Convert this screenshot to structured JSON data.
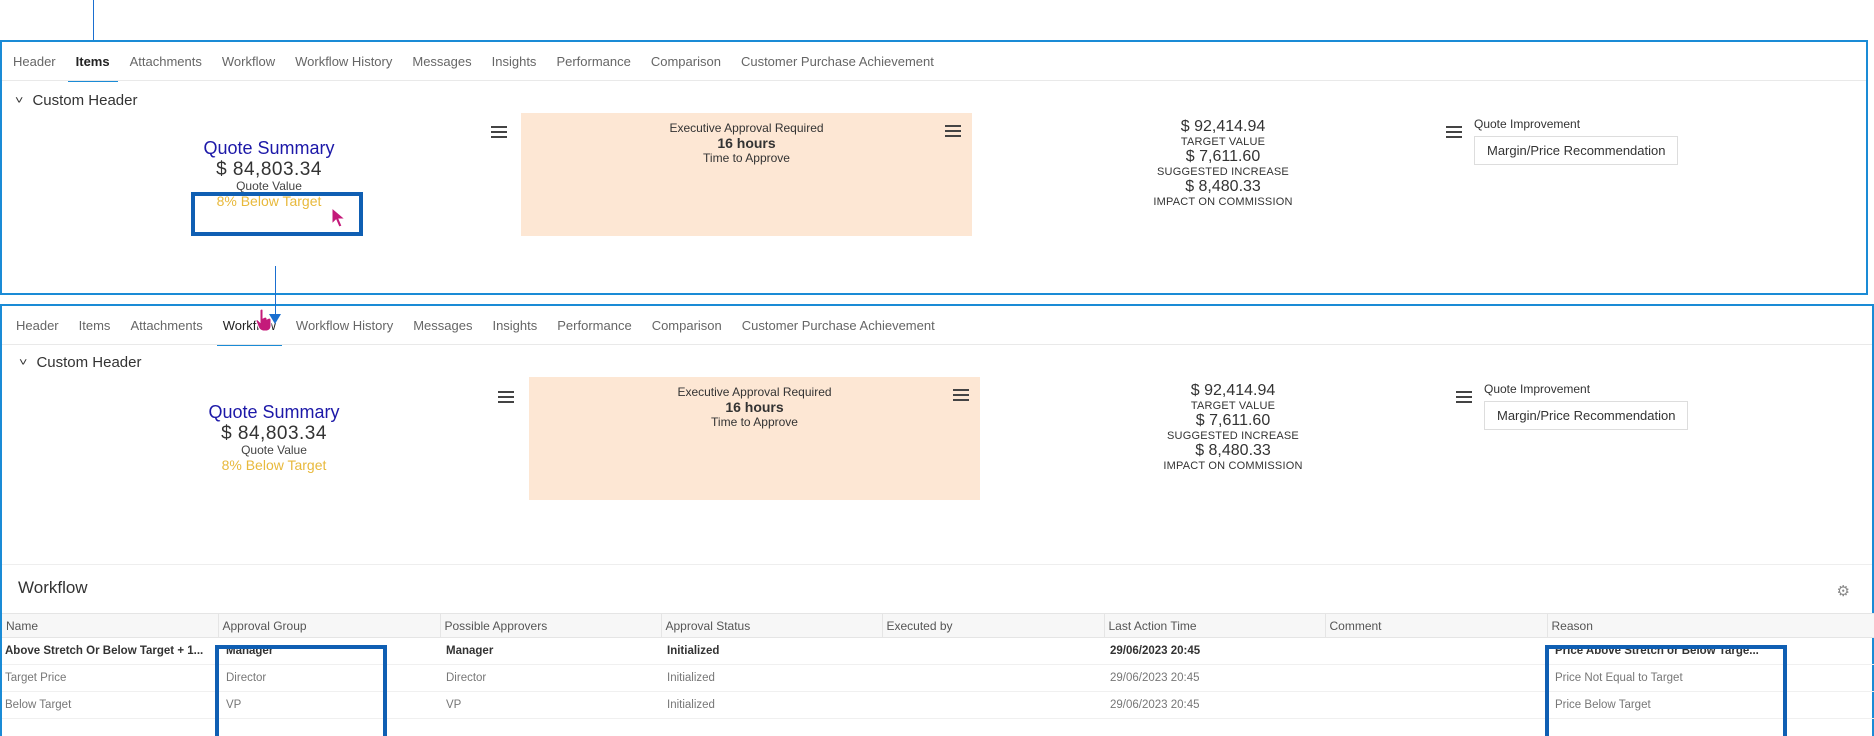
{
  "tabs": [
    "Header",
    "Items",
    "Attachments",
    "Workflow",
    "Workflow History",
    "Messages",
    "Insights",
    "Performance",
    "Comparison",
    "Customer Purchase Achievement"
  ],
  "panel1": {
    "active_tab": "Items"
  },
  "panel2": {
    "active_tab": "Workflow"
  },
  "custom_header": "Custom Header",
  "quote_summary": {
    "title": "Quote Summary",
    "value": "$ 84,803.34",
    "value_label": "Quote Value",
    "status": "8% Below Target"
  },
  "approval": {
    "line1": "Executive Approval Required",
    "line2": "16 hours",
    "line3": "Time to Approve"
  },
  "metrics": {
    "target_value": "$ 92,414.94",
    "target_label": "TARGET VALUE",
    "suggested_increase": "$ 7,611.60",
    "suggested_label": "SUGGESTED INCREASE",
    "impact": "$ 8,480.33",
    "impact_label": "IMPACT ON COMMISSION"
  },
  "quote_improvement": {
    "label": "Quote Improvement",
    "button": "Margin/Price Recommendation"
  },
  "workflow": {
    "title": "Workflow",
    "columns": [
      "Name",
      "Approval Group",
      "Possible Approvers",
      "Approval Status",
      "Executed by",
      "Last Action Time",
      "Comment",
      "Reason"
    ],
    "rows": [
      [
        "Above Stretch Or Below Target + 1...",
        "Manager",
        "Manager",
        "Initialized",
        "",
        "29/06/2023 20:45",
        "",
        "Price Above Stretch or Below Targe..."
      ],
      [
        "Target Price",
        "Director",
        "Director",
        "Initialized",
        "",
        "29/06/2023 20:45",
        "",
        "Price Not Equal to Target"
      ],
      [
        "Below Target",
        "VP",
        "VP",
        "Initialized",
        "",
        "29/06/2023 20:45",
        "",
        "Price Below Target"
      ]
    ]
  },
  "colors": {
    "accent": "#1a8bd6",
    "highlight": "#0f5fb3",
    "title_blue": "#1c18a8",
    "warning": "#e8b93c",
    "approval_bg": "#fde7d4"
  }
}
